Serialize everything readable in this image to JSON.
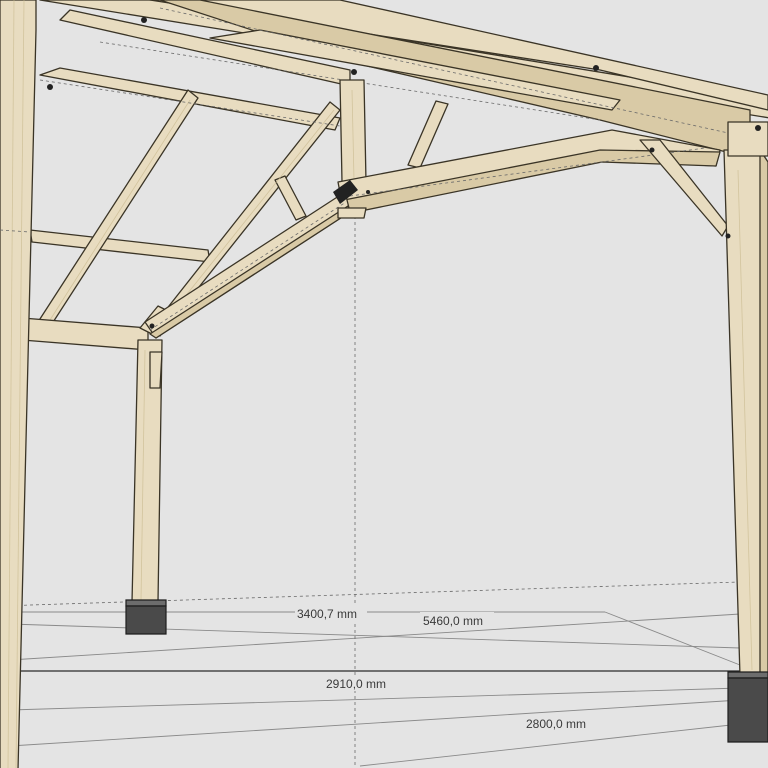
{
  "dimensions": [
    {
      "id": "dim-3400",
      "label": "3400,7 mm"
    },
    {
      "id": "dim-5460",
      "label": "5460,0 mm"
    },
    {
      "id": "dim-2910",
      "label": "2910,0 mm"
    },
    {
      "id": "dim-2800",
      "label": "2800,0 mm"
    }
  ],
  "colors": {
    "background": "#e4e4e4",
    "timber": "#e8dcc0",
    "edge": "#3a3426",
    "footing": "#4a4a4a"
  }
}
